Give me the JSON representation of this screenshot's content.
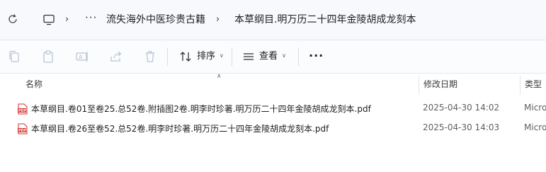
{
  "address_bar": {
    "more_label": "···",
    "breadcrumbs": [
      "流失海外中医珍贵古籍",
      "本草纲目.明万历二十四年金陵胡成龙刻本"
    ]
  },
  "toolbar": {
    "sort_label": "排序",
    "view_label": "查看",
    "more_label": "···"
  },
  "columns": {
    "name": "名称",
    "modified": "修改日期",
    "type": "类型"
  },
  "files": [
    {
      "name": "本草纲目.卷01至卷25.总52卷.附插图2卷.明李时珍著.明万历二十四年金陵胡成龙刻本.pdf",
      "modified": "2025-04-30 14:02",
      "type": "Micro",
      "icon": "pdf-file-icon"
    },
    {
      "name": "本草纲目.卷26至卷52.总52卷.明李时珍著.明万历二十四年金陵胡成龙刻本.pdf",
      "modified": "2025-04-30 14:03",
      "type": "Micro",
      "icon": "pdf-file-icon"
    }
  ],
  "colors": {
    "pdf_red": "#d0312d",
    "accent": "#1f1f1f"
  }
}
